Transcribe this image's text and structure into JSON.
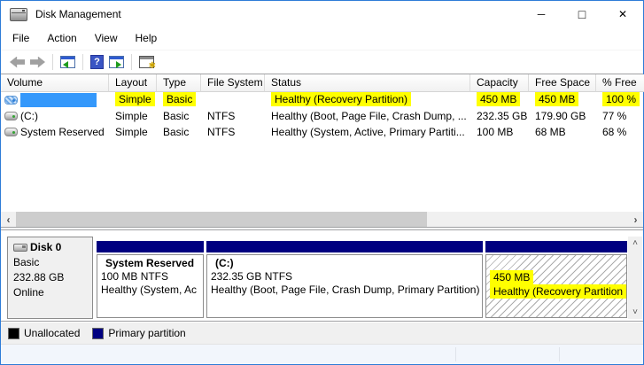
{
  "window": {
    "title": "Disk Management",
    "controls": {
      "minimize": "─",
      "maximize": "□",
      "close": "✕"
    }
  },
  "menu": {
    "items": [
      {
        "label": "File"
      },
      {
        "label": "Action"
      },
      {
        "label": "View"
      },
      {
        "label": "Help"
      }
    ]
  },
  "toolbar": {
    "buttons": [
      {
        "name": "back"
      },
      {
        "name": "forward"
      },
      {
        "name": "show-console-tree"
      },
      {
        "name": "help"
      },
      {
        "name": "show-action-pane"
      },
      {
        "name": "manage-extension"
      }
    ],
    "help_glyph": "?"
  },
  "volume_list": {
    "columns": [
      "Volume",
      "Layout",
      "Type",
      "File System",
      "Status",
      "Capacity",
      "Free Space",
      "% Free"
    ],
    "rows": [
      {
        "volume": "",
        "layout": "Simple",
        "type": "Basic",
        "file_system": "",
        "status": "Healthy (Recovery Partition)",
        "capacity": "450 MB",
        "free_space": "450 MB",
        "pct_free": "100 %",
        "selected": true,
        "highlighted": true
      },
      {
        "volume": "(C:)",
        "layout": "Simple",
        "type": "Basic",
        "file_system": "NTFS",
        "status": "Healthy (Boot, Page File, Crash Dump, ...",
        "capacity": "232.35 GB",
        "free_space": "179.90 GB",
        "pct_free": "77 %",
        "selected": false,
        "highlighted": false
      },
      {
        "volume": "System Reserved",
        "layout": "Simple",
        "type": "Basic",
        "file_system": "NTFS",
        "status": "Healthy (System, Active, Primary Partiti...",
        "capacity": "100 MB",
        "free_space": "68 MB",
        "pct_free": "68 %",
        "selected": false,
        "highlighted": false
      }
    ]
  },
  "scrollbars": {
    "horizontal": {
      "left_arrow": "‹",
      "right_arrow": "›"
    },
    "vertical": {
      "up_arrow": "˄",
      "down_arrow": "˅"
    }
  },
  "disk_view": {
    "disk": {
      "label": "Disk 0",
      "type": "Basic",
      "size": "232.88 GB",
      "status": "Online"
    },
    "partitions": [
      {
        "name": "System Reserved",
        "size_line": "100 MB NTFS",
        "status_line": "Healthy (System, Ac",
        "selected": false
      },
      {
        "name": "(C:)",
        "size_line": "232.35 GB NTFS",
        "status_line": "Healthy (Boot, Page File, Crash Dump, Primary Partition)",
        "selected": false
      },
      {
        "name": "",
        "size_line": "450 MB",
        "status_line": "Healthy (Recovery Partition",
        "selected": true,
        "highlighted": true
      }
    ]
  },
  "legend": {
    "items": [
      {
        "label": "Unallocated",
        "color": "#000000"
      },
      {
        "label": "Primary partition",
        "color": "#000080"
      }
    ]
  },
  "status_bar": {
    "text": ""
  },
  "colors": {
    "window_border": "#2e7cd8",
    "selection": "#3498fb",
    "highlight": "#ffff00",
    "primary_partition": "#000080",
    "unallocated": "#000000"
  }
}
